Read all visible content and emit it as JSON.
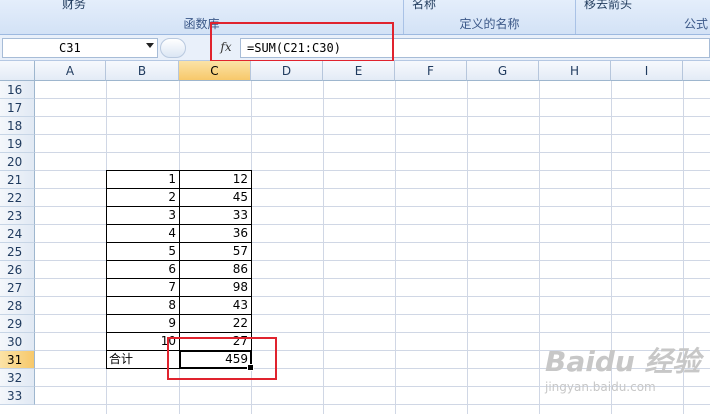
{
  "ribbon": {
    "groups": [
      "函数库",
      "定义的名称",
      "公式"
    ],
    "partial_top": [
      "财务",
      "名称",
      "移去箭头"
    ]
  },
  "formula_bar": {
    "name_box": "C31",
    "fx_label": "fx",
    "formula": "=SUM(C21:C30)"
  },
  "columns": [
    "A",
    "B",
    "C",
    "D",
    "E",
    "F",
    "G",
    "H",
    "I"
  ],
  "active_column": "C",
  "rows": [
    "16",
    "17",
    "18",
    "19",
    "20",
    "21",
    "22",
    "23",
    "24",
    "25",
    "26",
    "27",
    "28",
    "29",
    "30",
    "31",
    "32",
    "33"
  ],
  "active_row": "31",
  "table": {
    "b_values": [
      "1",
      "2",
      "3",
      "4",
      "5",
      "6",
      "7",
      "8",
      "9",
      "10"
    ],
    "c_values": [
      "12",
      "45",
      "33",
      "36",
      "57",
      "86",
      "98",
      "43",
      "22",
      "27"
    ],
    "total_label": "合计",
    "total_value": "459"
  },
  "watermark": {
    "logo": "Baidu 经验",
    "url": "jingyan.baidu.com"
  },
  "colors": {
    "highlight_box": "#e0232e",
    "active_header": "#f7c86a"
  }
}
